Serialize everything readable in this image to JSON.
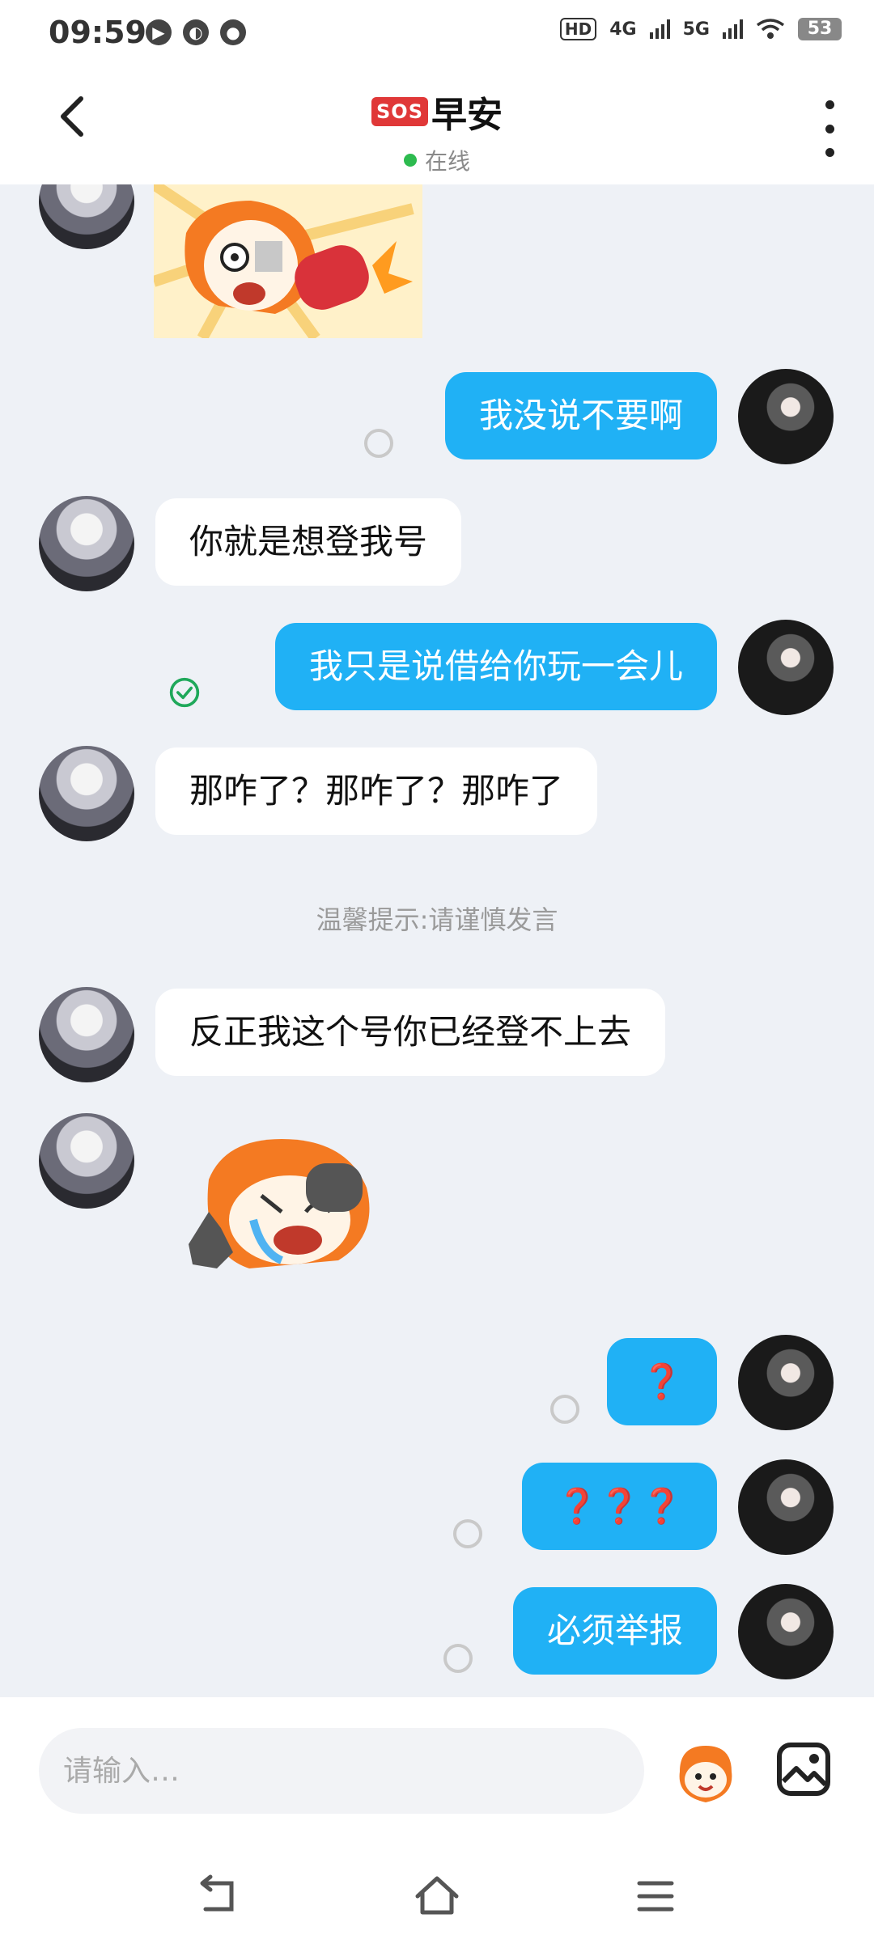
{
  "status_bar": {
    "time": "09:59",
    "hd_label": "HD",
    "net1": "4G",
    "net2": "5G",
    "battery": "53"
  },
  "header": {
    "badge": "SOS",
    "title": "早安",
    "status": "在线"
  },
  "messages": {
    "m1": "我没说不要啊",
    "m2": "你就是想登我号",
    "m3": "我只是说借给你玩一会儿",
    "m4": "那咋了？那咋了？那咋了",
    "notice": "温馨提示:请谨慎发言",
    "m5": "反正我这个号你已经登不上去",
    "m6": "❓",
    "m7": "❓❓❓",
    "m8": "必须举报"
  },
  "input": {
    "placeholder": "请输入…"
  },
  "colors": {
    "accent": "#20b1f5",
    "online": "#2dbb4f",
    "question": "#e1333b"
  }
}
